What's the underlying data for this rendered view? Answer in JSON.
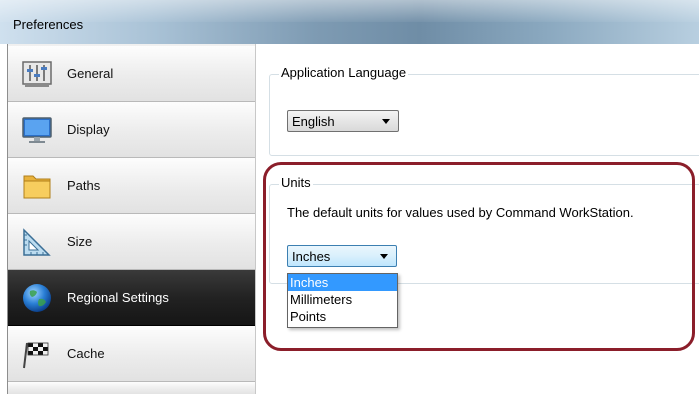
{
  "window": {
    "title": "Preferences"
  },
  "sidebar": {
    "items": [
      {
        "label": "General",
        "icon": "settings-sliders-icon",
        "active": false
      },
      {
        "label": "Display",
        "icon": "monitor-icon",
        "active": false
      },
      {
        "label": "Paths",
        "icon": "folder-icon",
        "active": false
      },
      {
        "label": "Size",
        "icon": "ruler-icon",
        "active": false
      },
      {
        "label": "Regional Settings",
        "icon": "globe-icon",
        "active": true
      },
      {
        "label": "Cache",
        "icon": "checkered-flag-icon",
        "active": false
      }
    ]
  },
  "application_language": {
    "title": "Application Language",
    "selected": "English"
  },
  "units": {
    "title": "Units",
    "description": "The default units for values used by Command WorkStation.",
    "selected": "Inches",
    "options": [
      "Inches",
      "Millimeters",
      "Points"
    ],
    "highlighted_option": "Inches"
  },
  "colors": {
    "active_nav_bg": "#1f1f1f",
    "selection_blue": "#3399ff",
    "annotation_ring": "#8b1e2a"
  }
}
